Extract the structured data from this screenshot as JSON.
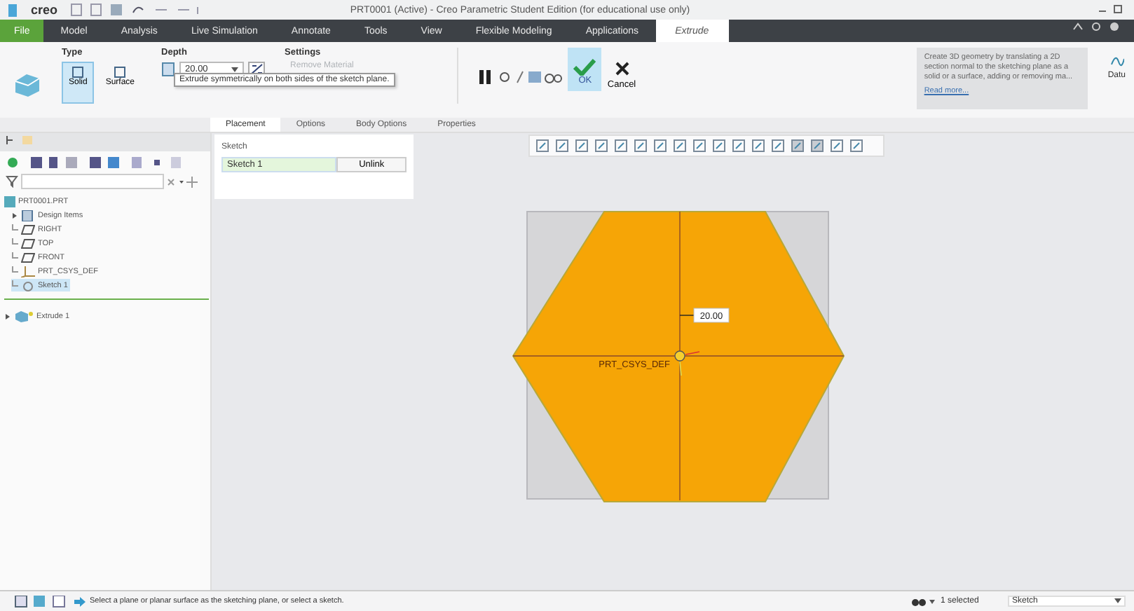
{
  "window": {
    "logo": "creo",
    "title": "PRT0001 (Active) - Creo Parametric Student Edition (for educational use only)"
  },
  "menu_tabs": [
    {
      "label": "File",
      "selected": false,
      "kind": "file"
    },
    {
      "label": "Model",
      "selected": false,
      "kind": "tab"
    },
    {
      "label": "Analysis",
      "selected": false,
      "kind": "tab"
    },
    {
      "label": "Live Simulation",
      "selected": false,
      "kind": "tab"
    },
    {
      "label": "Annotate",
      "selected": false,
      "kind": "tab"
    },
    {
      "label": "Tools",
      "selected": false,
      "kind": "tab"
    },
    {
      "label": "View",
      "selected": false,
      "kind": "tab"
    },
    {
      "label": "Flexible Modeling",
      "selected": false,
      "kind": "tab"
    },
    {
      "label": "Applications",
      "selected": false,
      "kind": "tab"
    },
    {
      "label": "Extrude",
      "selected": true,
      "kind": "tab"
    }
  ],
  "ribbon": {
    "type_group": {
      "title": "Type",
      "options": [
        {
          "label": "Solid",
          "selected": true
        },
        {
          "label": "Surface",
          "selected": false
        }
      ]
    },
    "depth_group": {
      "title": "Depth",
      "value": "20.00"
    },
    "settings_group": {
      "title": "Settings",
      "remove_material": {
        "label": "Remove Material",
        "disabled": true
      }
    },
    "ok": {
      "label": "OK"
    },
    "cancel": {
      "label": "Cancel"
    },
    "help": {
      "text": "Create 3D geometry by translating a 2D section normal to the sketching plane as a solid or a surface, adding or removing ma...",
      "link": "Read more..."
    },
    "datum": {
      "label": "Datu"
    },
    "tooltip": "Extrude symmetrically on both sides of the sketch plane."
  },
  "sub_tabs": [
    {
      "label": "Placement",
      "selected": true
    },
    {
      "label": "Options",
      "selected": false
    },
    {
      "label": "Body Options",
      "selected": false
    },
    {
      "label": "Properties",
      "selected": false
    }
  ],
  "placement_panel": {
    "label": "Sketch",
    "value": "Sketch 1",
    "button": "Unlink"
  },
  "tree": {
    "items": [
      {
        "label": "PRT0001.PRT",
        "kind": "part",
        "selected": false,
        "children": [
          {
            "label": "Design Items",
            "kind": "folder",
            "selected": false
          },
          {
            "label": "RIGHT",
            "kind": "plane",
            "selected": false
          },
          {
            "label": "TOP",
            "kind": "plane",
            "selected": false
          },
          {
            "label": "FRONT",
            "kind": "plane",
            "selected": false
          },
          {
            "label": "PRT_CSYS_DEF",
            "kind": "csys",
            "selected": false
          },
          {
            "label": "Sketch 1",
            "kind": "sketch",
            "selected": true
          }
        ]
      }
    ],
    "new_feature": {
      "label": "Extrude 1",
      "kind": "feature"
    }
  },
  "canvas": {
    "dimension": "20.00",
    "csys_label": "PRT_CSYS_DEF"
  },
  "status_bar": {
    "message": "Select a plane or planar surface as the sketching plane, or select a sketch.",
    "selection": "1 selected",
    "filter": "Sketch"
  }
}
